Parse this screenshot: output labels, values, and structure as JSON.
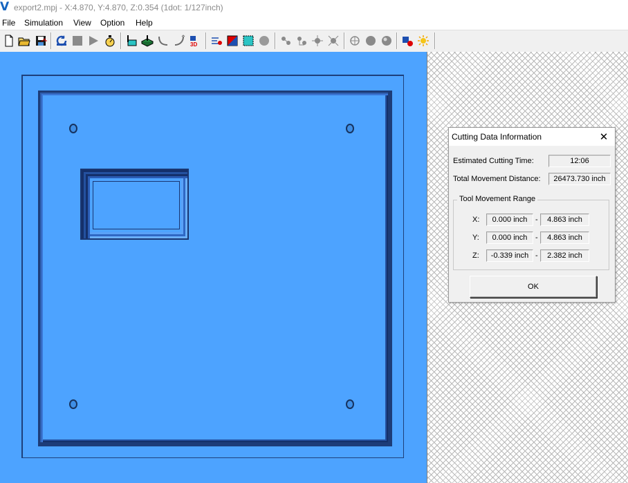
{
  "window": {
    "title": "export2.mpj - X:4.870, Y:4.870, Z:0.354 (1dot: 1/127inch)",
    "logo_letter": "V"
  },
  "menu": [
    "File",
    "Simulation",
    "View",
    "Option",
    "Help"
  ],
  "toolbar": {
    "buttons": [
      "new-file-icon",
      "open-folder-icon",
      "save-icon",
      "rewind-icon",
      "stop-icon",
      "play-icon",
      "speed-icon",
      "cutting-path-icon",
      "stock-model-icon",
      "tool-path-curve-icon",
      "tool-path-arc-icon",
      "view-3d-icon",
      "trace-icon",
      "color-icon",
      "grid-icon",
      "sphere-icon",
      "view-front-icon",
      "view-side-icon",
      "view-top-icon",
      "view-iso-icon",
      "light-off-icon",
      "shade-icon",
      "render-icon",
      "settings-icon",
      "light-on-icon"
    ],
    "view_3d_label": "3D"
  },
  "colors": {
    "stock": "#4da3ff",
    "edge": "#1d3c78"
  },
  "dialog": {
    "title": "Cutting Data Information",
    "estimated_time_label": "Estimated Cutting Time:",
    "estimated_time_value": "12:06",
    "total_distance_label": "Total Movement Distance:",
    "total_distance_value": "26473.730 inch",
    "range_group_title": "Tool Movement Range",
    "range": {
      "x": {
        "label": "X:",
        "min": "0.000 inch",
        "max": "4.863 inch"
      },
      "y": {
        "label": "Y:",
        "min": "0.000 inch",
        "max": "4.863 inch"
      },
      "z": {
        "label": "Z:",
        "min": "-0.339 inch",
        "max": "2.382 inch"
      }
    },
    "range_separator": "-",
    "ok_label": "OK",
    "close_glyph": "✕"
  }
}
